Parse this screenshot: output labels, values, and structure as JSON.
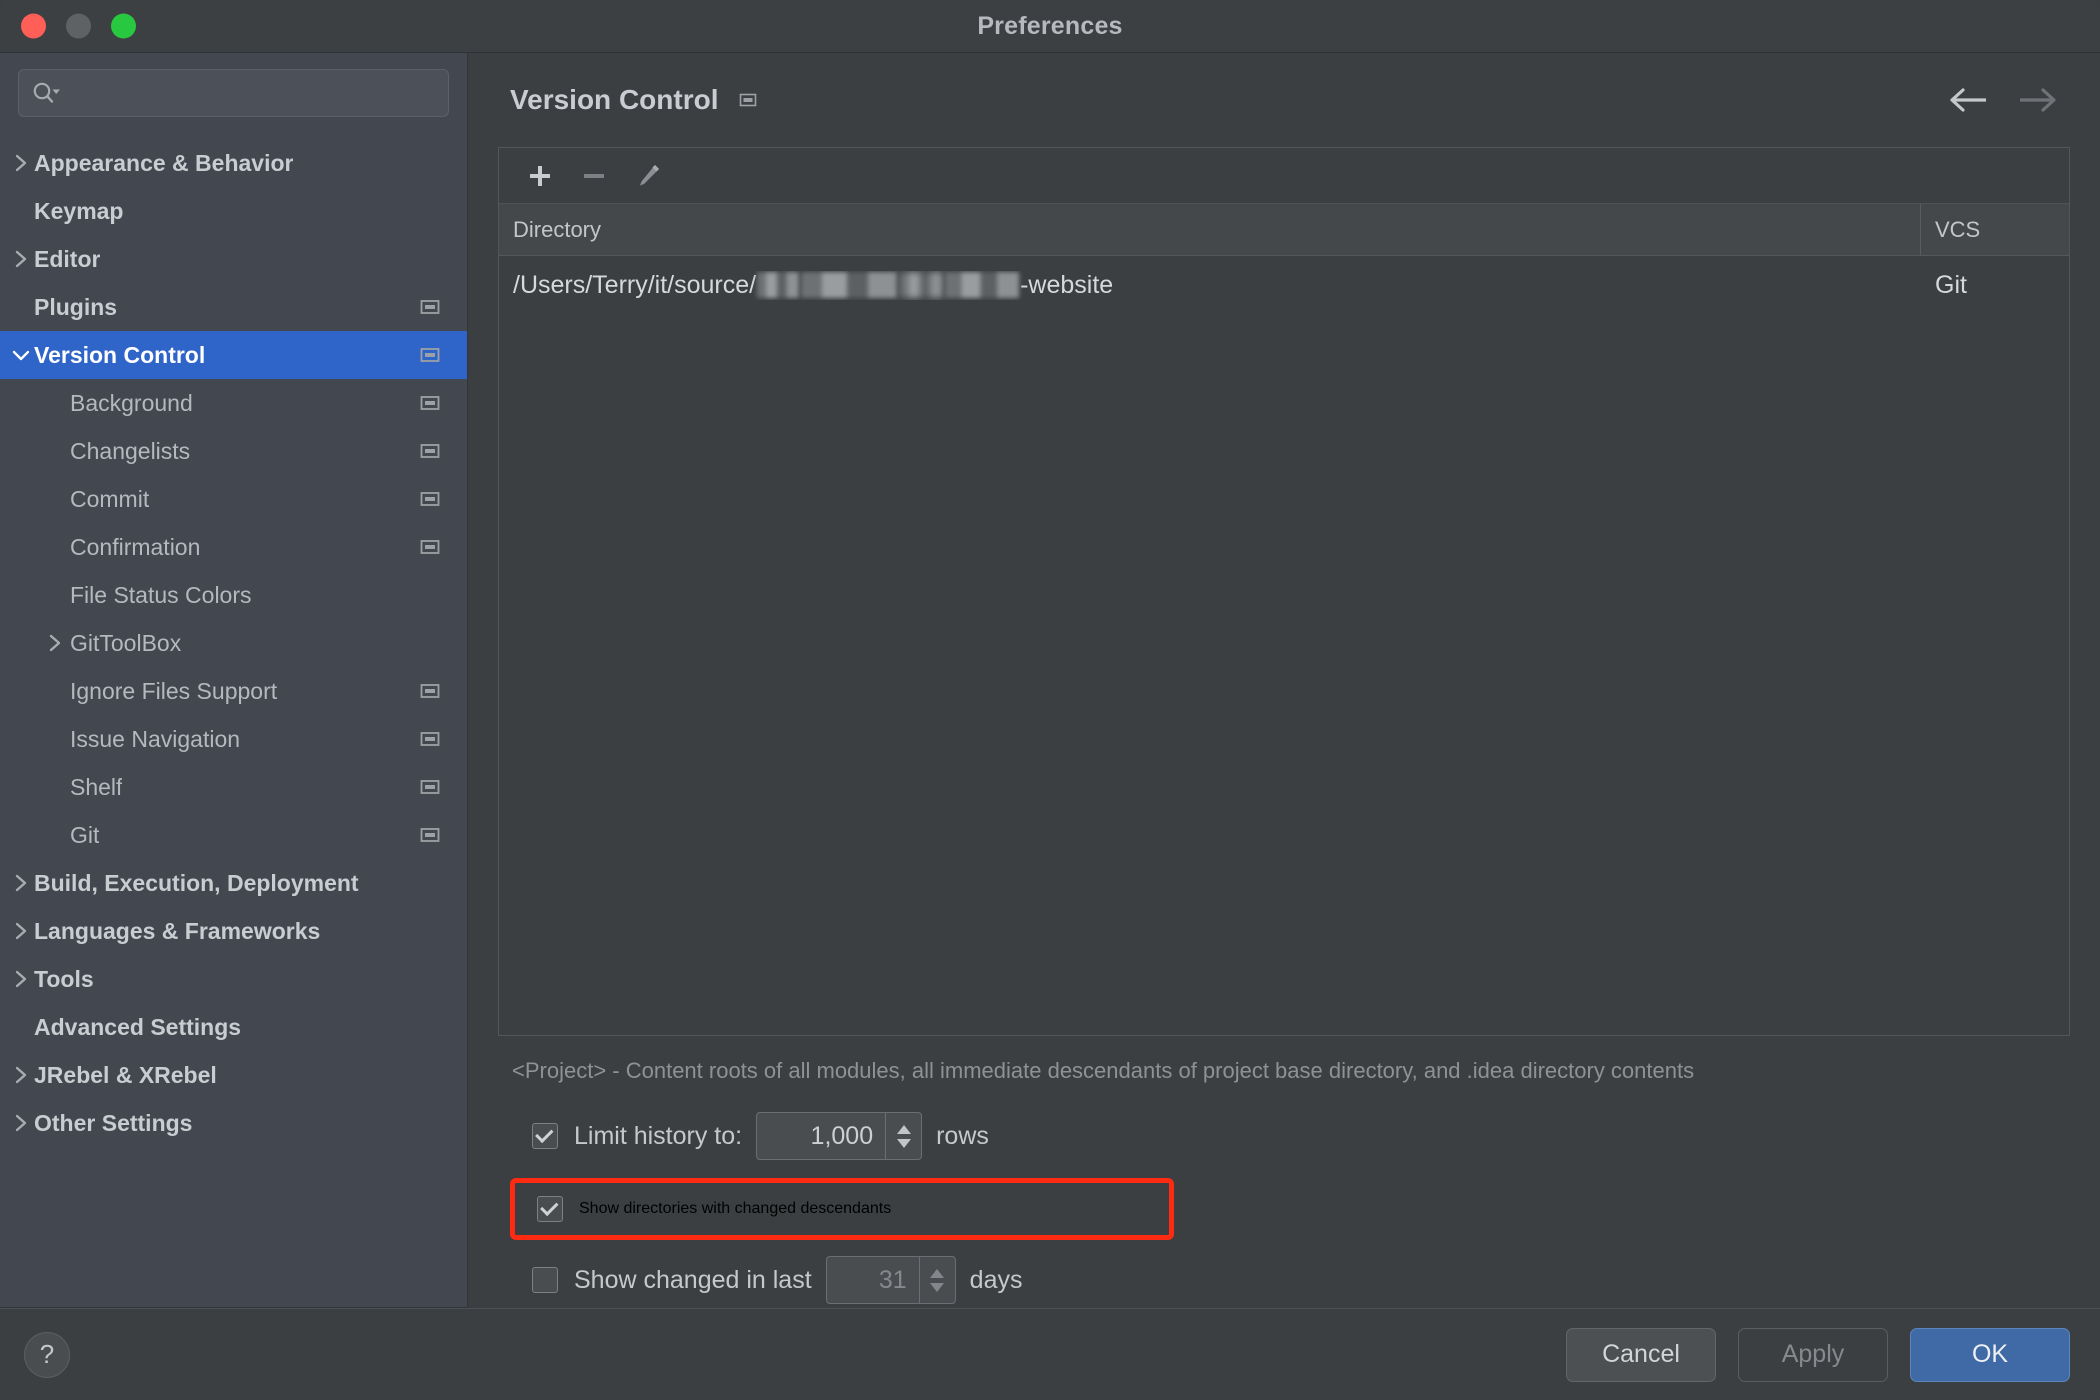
{
  "window": {
    "title": "Preferences",
    "traffic_lights": [
      "close-button",
      "minimize-button",
      "zoom-button"
    ]
  },
  "search": {
    "value": "",
    "placeholder": ""
  },
  "sidebar": {
    "items": [
      {
        "label": "Appearance & Behavior",
        "level": 0,
        "arrow": "right",
        "badge": false,
        "selected": false
      },
      {
        "label": "Keymap",
        "level": 0,
        "arrow": "none",
        "badge": false,
        "selected": false
      },
      {
        "label": "Editor",
        "level": 0,
        "arrow": "right",
        "badge": false,
        "selected": false
      },
      {
        "label": "Plugins",
        "level": 0,
        "arrow": "none",
        "badge": true,
        "selected": false
      },
      {
        "label": "Version Control",
        "level": 0,
        "arrow": "down",
        "badge": true,
        "selected": true
      },
      {
        "label": "Background",
        "level": 1,
        "arrow": "none",
        "badge": true,
        "selected": false
      },
      {
        "label": "Changelists",
        "level": 1,
        "arrow": "none",
        "badge": true,
        "selected": false
      },
      {
        "label": "Commit",
        "level": 1,
        "arrow": "none",
        "badge": true,
        "selected": false
      },
      {
        "label": "Confirmation",
        "level": 1,
        "arrow": "none",
        "badge": true,
        "selected": false
      },
      {
        "label": "File Status Colors",
        "level": 1,
        "arrow": "none",
        "badge": false,
        "selected": false
      },
      {
        "label": "GitToolBox",
        "level": 1,
        "arrow": "right",
        "badge": false,
        "selected": false
      },
      {
        "label": "Ignore Files Support",
        "level": 1,
        "arrow": "none",
        "badge": true,
        "selected": false
      },
      {
        "label": "Issue Navigation",
        "level": 1,
        "arrow": "none",
        "badge": true,
        "selected": false
      },
      {
        "label": "Shelf",
        "level": 1,
        "arrow": "none",
        "badge": true,
        "selected": false
      },
      {
        "label": "Git",
        "level": 1,
        "arrow": "none",
        "badge": true,
        "selected": false
      },
      {
        "label": "Build, Execution, Deployment",
        "level": 0,
        "arrow": "right",
        "badge": false,
        "selected": false
      },
      {
        "label": "Languages & Frameworks",
        "level": 0,
        "arrow": "right",
        "badge": false,
        "selected": false
      },
      {
        "label": "Tools",
        "level": 0,
        "arrow": "right",
        "badge": false,
        "selected": false
      },
      {
        "label": "Advanced Settings",
        "level": 0,
        "arrow": "none",
        "badge": false,
        "selected": false
      },
      {
        "label": "JRebel & XRebel",
        "level": 0,
        "arrow": "right",
        "badge": false,
        "selected": false
      },
      {
        "label": "Other Settings",
        "level": 0,
        "arrow": "right",
        "badge": false,
        "selected": false
      }
    ]
  },
  "main": {
    "page_title": "Version Control",
    "nav_back_icon": "arrow-left-icon",
    "nav_forward_icon": "arrow-right-icon",
    "toolbar": {
      "add_icon": "plus-icon",
      "remove_icon": "minus-icon",
      "edit_icon": "pencil-icon"
    },
    "table": {
      "columns": [
        "Directory",
        "VCS"
      ],
      "rows": [
        {
          "directory_prefix": "/Users/Terry/it/source/",
          "directory_redacted": true,
          "directory_suffix": "-website",
          "vcs": "Git"
        }
      ]
    },
    "hint": "<Project> - Content roots of all modules, all immediate descendants of project base directory, and .idea directory contents",
    "options": {
      "limit_history": {
        "label": "Limit history to:",
        "checked": true,
        "value": "1,000",
        "unit": "rows"
      },
      "show_directories": {
        "label": "Show directories with changed descendants",
        "checked": true,
        "highlighted": true
      },
      "show_changed_in_last": {
        "label": "Show changed in last",
        "checked": false,
        "value": "31",
        "unit": "days"
      }
    }
  },
  "footer": {
    "help_label": "?",
    "cancel_label": "Cancel",
    "apply_label": "Apply",
    "ok_label": "OK"
  },
  "colors": {
    "accent_selection": "#2f65c9",
    "ok_button": "#3f6aa5",
    "highlight_box": "#fc2b12",
    "sidebar_bg": "#434750",
    "main_bg": "#3c3f41",
    "titlebar_bg": "#3c4043"
  }
}
